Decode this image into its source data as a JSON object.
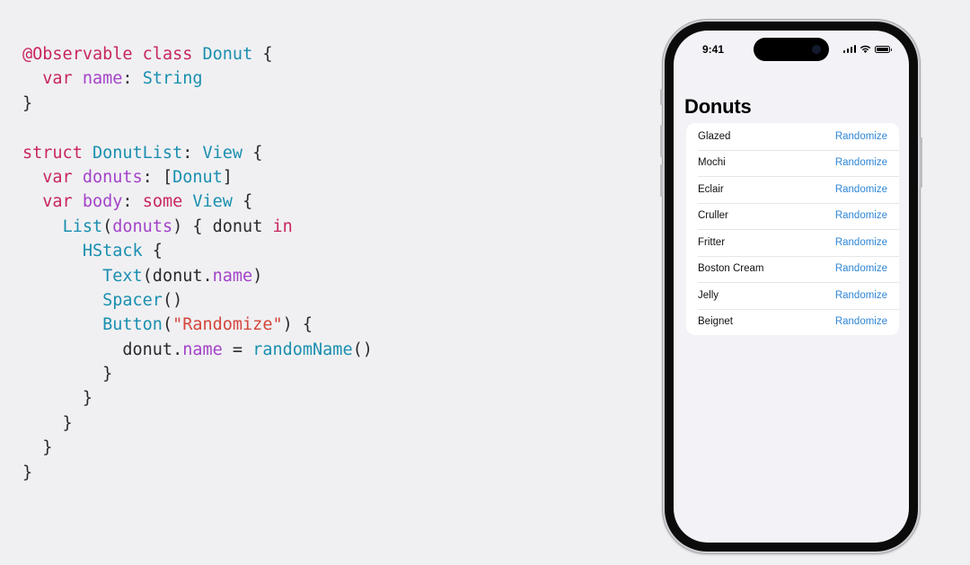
{
  "code": {
    "lines": [
      [
        [
          "kw",
          "@Observable"
        ],
        [
          "pl",
          " "
        ],
        [
          "kw",
          "class"
        ],
        [
          "pl",
          " "
        ],
        [
          "ty",
          "Donut"
        ],
        [
          "pl",
          " {"
        ]
      ],
      [
        [
          "pl",
          "  "
        ],
        [
          "kw",
          "var"
        ],
        [
          "pl",
          " "
        ],
        [
          "pr",
          "name"
        ],
        [
          "pl",
          ": "
        ],
        [
          "ty",
          "String"
        ]
      ],
      [
        [
          "pl",
          "}"
        ]
      ],
      [
        [
          "pl",
          ""
        ]
      ],
      [
        [
          "kw",
          "struct"
        ],
        [
          "pl",
          " "
        ],
        [
          "ty",
          "DonutList"
        ],
        [
          "pl",
          ": "
        ],
        [
          "ty",
          "View"
        ],
        [
          "pl",
          " {"
        ]
      ],
      [
        [
          "pl",
          "  "
        ],
        [
          "kw",
          "var"
        ],
        [
          "pl",
          " "
        ],
        [
          "pr",
          "donuts"
        ],
        [
          "pl",
          ": ["
        ],
        [
          "ty",
          "Donut"
        ],
        [
          "pl",
          "]"
        ]
      ],
      [
        [
          "pl",
          "  "
        ],
        [
          "kw",
          "var"
        ],
        [
          "pl",
          " "
        ],
        [
          "pr",
          "body"
        ],
        [
          "pl",
          ": "
        ],
        [
          "kw",
          "some"
        ],
        [
          "pl",
          " "
        ],
        [
          "ty",
          "View"
        ],
        [
          "pl",
          " {"
        ]
      ],
      [
        [
          "pl",
          "    "
        ],
        [
          "ty",
          "List"
        ],
        [
          "pl",
          "("
        ],
        [
          "pr",
          "donuts"
        ],
        [
          "pl",
          ") { donut "
        ],
        [
          "kw",
          "in"
        ]
      ],
      [
        [
          "pl",
          "      "
        ],
        [
          "ty",
          "HStack"
        ],
        [
          "pl",
          " {"
        ]
      ],
      [
        [
          "pl",
          "        "
        ],
        [
          "ty",
          "Text"
        ],
        [
          "pl",
          "(donut."
        ],
        [
          "pr",
          "name"
        ],
        [
          "pl",
          ")"
        ]
      ],
      [
        [
          "pl",
          "        "
        ],
        [
          "ty",
          "Spacer"
        ],
        [
          "pl",
          "()"
        ]
      ],
      [
        [
          "pl",
          "        "
        ],
        [
          "ty",
          "Button"
        ],
        [
          "pl",
          "("
        ],
        [
          "st",
          "\"Randomize\""
        ],
        [
          "pl",
          ") {"
        ]
      ],
      [
        [
          "pl",
          "          donut."
        ],
        [
          "pr",
          "name"
        ],
        [
          "pl",
          " = "
        ],
        [
          "ty",
          "randomName"
        ],
        [
          "pl",
          "()"
        ]
      ],
      [
        [
          "pl",
          "        }"
        ]
      ],
      [
        [
          "pl",
          "      }"
        ]
      ],
      [
        [
          "pl",
          "    }"
        ]
      ],
      [
        [
          "pl",
          "  }"
        ]
      ],
      [
        [
          "pl",
          "}"
        ]
      ]
    ]
  },
  "phone": {
    "status_time": "9:41",
    "nav_title": "Donuts",
    "button_label": "Randomize",
    "items": [
      "Glazed",
      "Mochi",
      "Eclair",
      "Cruller",
      "Fritter",
      "Boston Cream",
      "Jelly",
      "Beignet"
    ]
  },
  "colors": {
    "keyword": "#c8265c",
    "type": "#1a8fb0",
    "property": "#a443c9",
    "string": "#d4453a",
    "accent": "#2f86d6"
  },
  "icons": [
    "signal-icon",
    "wifi-icon",
    "battery-icon"
  ]
}
